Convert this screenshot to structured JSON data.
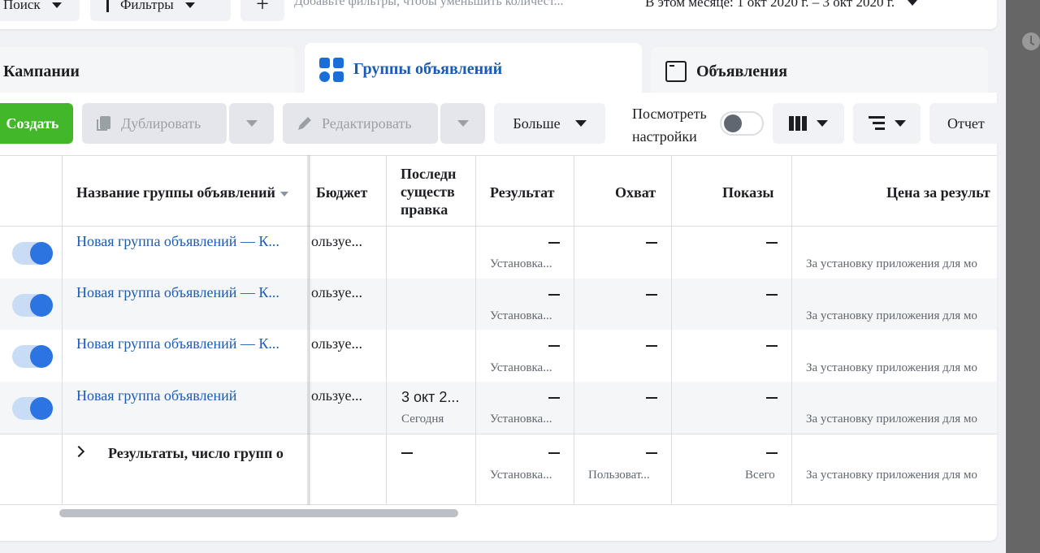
{
  "filters": {
    "search_label": "Поиск",
    "filters_label": "Фильтры",
    "add_label": "+",
    "hint": "Добавьте фильтры, чтобы уменьшить количест...",
    "date_range": "В этом месяце: 1 окт 2020 г. – 3 окт 2020 г."
  },
  "tabs": [
    {
      "label": "Кампании",
      "active": false
    },
    {
      "label": "Группы объявлений",
      "active": true
    },
    {
      "label": "Объявления",
      "active": false
    }
  ],
  "toolbar": {
    "create": "Создать",
    "duplicate": "Дублировать",
    "edit": "Редактировать",
    "more": "Больше",
    "view_settings": "Посмотреть настройки",
    "report": "Отчет"
  },
  "columns": {
    "name": "Название группы объявлений",
    "budget": "Бюджет",
    "last_edit": "Последн существ правка",
    "result": "Результат",
    "reach": "Охват",
    "impressions": "Показы",
    "cost": "Цена за результ"
  },
  "rows": [
    {
      "name": "Новая группа объявлений — К...",
      "budget": "ользуе...",
      "edit_date": "",
      "edit_sub": "",
      "result": "—",
      "result_sub": "Установка...",
      "reach": "—",
      "impr": "—",
      "cost": "За установку приложения для мо"
    },
    {
      "name": "Новая группа объявлений — К...",
      "budget": "ользуе...",
      "edit_date": "",
      "edit_sub": "",
      "result": "—",
      "result_sub": "Установка...",
      "reach": "—",
      "impr": "—",
      "cost": "За установку приложения для мо"
    },
    {
      "name": "Новая группа объявлений — К...",
      "budget": "ользуе...",
      "edit_date": "",
      "edit_sub": "",
      "result": "—",
      "result_sub": "Установка...",
      "reach": "—",
      "impr": "—",
      "cost": "За установку приложения для мо"
    },
    {
      "name": "Новая группа объявлений",
      "budget": "ользуе...",
      "edit_date": "3 окт 2...",
      "edit_sub": "Сегодня",
      "result": "—",
      "result_sub": "Установка...",
      "reach": "—",
      "impr": "—",
      "cost": "За установку приложения для мо"
    }
  ],
  "totals": {
    "label": "Результаты, число групп о",
    "result_sub": "Установка...",
    "reach_sub": "Пользоват...",
    "impr_sub": "Всего",
    "cost_sub": "За установку приложения для мо"
  },
  "colors": {
    "accent": "#1a5bb5",
    "create": "#42b72a",
    "toggle_on": "#2d74e3"
  }
}
